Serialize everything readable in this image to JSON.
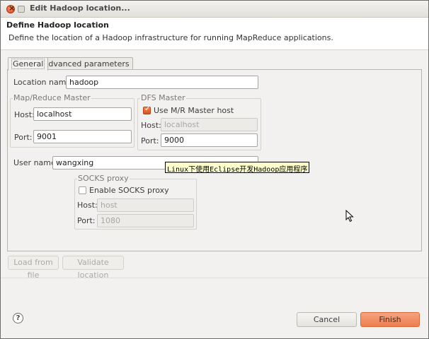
{
  "window": {
    "title": "Edit Hadoop location..."
  },
  "header": {
    "title": "Define Hadoop location",
    "description": "Define the location of a Hadoop infrastructure for running MapReduce applications."
  },
  "tabs": [
    {
      "label": "General",
      "active": true
    },
    {
      "label": "Advanced parameters",
      "active": false
    }
  ],
  "general": {
    "location_name_label": "Location name:",
    "location_name_value": "hadoop",
    "mr_master": {
      "title": "Map/Reduce Master",
      "host_label": "Host:",
      "host_value": "localhost",
      "port_label": "Port:",
      "port_value": "9001"
    },
    "dfs_master": {
      "title": "DFS Master",
      "use_mr_label": "Use M/R Master host",
      "use_mr_checked": true,
      "host_label": "Host:",
      "host_value": "localhost",
      "port_label": "Port:",
      "port_value": "9000"
    },
    "user_name_label": "User name:",
    "user_name_value": "wangxing",
    "socks": {
      "title": "SOCKS proxy",
      "enable_label": "Enable SOCKS proxy",
      "enable_checked": false,
      "host_label": "Host:",
      "host_value": "host",
      "port_label": "Port:",
      "port_value": "1080"
    }
  },
  "tooltip": "Linux下使用Eclipse开发Hadoop应用程序",
  "actions": {
    "load": "Load from file",
    "validate": "Validate location",
    "cancel": "Cancel",
    "finish": "Finish"
  },
  "colors": {
    "accent": "#ec7e4f",
    "tooltip_bg": "#ffffcf"
  }
}
